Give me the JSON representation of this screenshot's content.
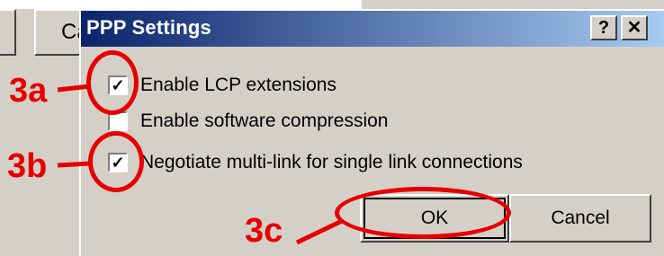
{
  "background_dialog": {
    "cancel_partial_label": "Ca"
  },
  "dialog": {
    "title": "PPP Settings",
    "help_button": "?",
    "close_button": "✕",
    "options": [
      {
        "label": "Enable LCP extensions",
        "checked": true,
        "check_mark": "✓"
      },
      {
        "label": "Enable software compression",
        "checked": false,
        "check_mark": ""
      },
      {
        "label": "Negotiate multi-link for single link connections",
        "checked": true,
        "check_mark": "✓"
      }
    ],
    "ok_label": "OK",
    "cancel_label": "Cancel"
  },
  "annotations": {
    "a": "3a",
    "b": "3b",
    "c": "3c"
  },
  "colors": {
    "annotation": "#e60000",
    "titlebar_start": "#0a246a",
    "titlebar_end": "#a6caf0",
    "dialog_face": "#d4d0c8"
  }
}
